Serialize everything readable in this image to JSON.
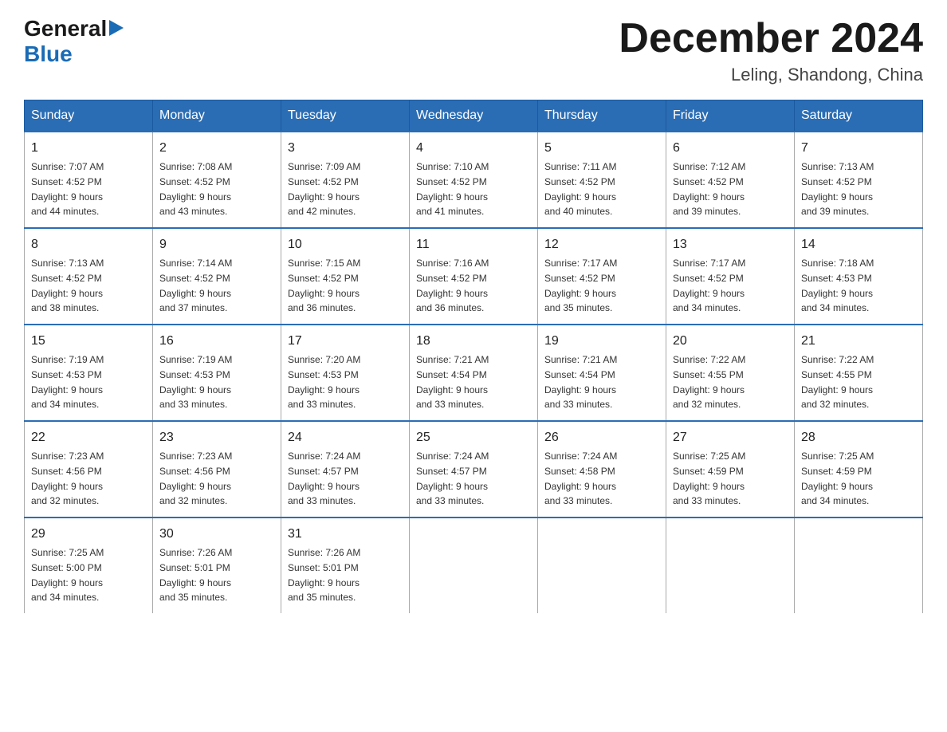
{
  "logo": {
    "general": "General",
    "arrow": "▶",
    "blue": "Blue"
  },
  "title": {
    "month_year": "December 2024",
    "location": "Leling, Shandong, China"
  },
  "headers": [
    "Sunday",
    "Monday",
    "Tuesday",
    "Wednesday",
    "Thursday",
    "Friday",
    "Saturday"
  ],
  "weeks": [
    [
      {
        "day": "1",
        "sunrise": "7:07 AM",
        "sunset": "4:52 PM",
        "daylight": "9 hours and 44 minutes."
      },
      {
        "day": "2",
        "sunrise": "7:08 AM",
        "sunset": "4:52 PM",
        "daylight": "9 hours and 43 minutes."
      },
      {
        "day": "3",
        "sunrise": "7:09 AM",
        "sunset": "4:52 PM",
        "daylight": "9 hours and 42 minutes."
      },
      {
        "day": "4",
        "sunrise": "7:10 AM",
        "sunset": "4:52 PM",
        "daylight": "9 hours and 41 minutes."
      },
      {
        "day": "5",
        "sunrise": "7:11 AM",
        "sunset": "4:52 PM",
        "daylight": "9 hours and 40 minutes."
      },
      {
        "day": "6",
        "sunrise": "7:12 AM",
        "sunset": "4:52 PM",
        "daylight": "9 hours and 39 minutes."
      },
      {
        "day": "7",
        "sunrise": "7:13 AM",
        "sunset": "4:52 PM",
        "daylight": "9 hours and 39 minutes."
      }
    ],
    [
      {
        "day": "8",
        "sunrise": "7:13 AM",
        "sunset": "4:52 PM",
        "daylight": "9 hours and 38 minutes."
      },
      {
        "day": "9",
        "sunrise": "7:14 AM",
        "sunset": "4:52 PM",
        "daylight": "9 hours and 37 minutes."
      },
      {
        "day": "10",
        "sunrise": "7:15 AM",
        "sunset": "4:52 PM",
        "daylight": "9 hours and 36 minutes."
      },
      {
        "day": "11",
        "sunrise": "7:16 AM",
        "sunset": "4:52 PM",
        "daylight": "9 hours and 36 minutes."
      },
      {
        "day": "12",
        "sunrise": "7:17 AM",
        "sunset": "4:52 PM",
        "daylight": "9 hours and 35 minutes."
      },
      {
        "day": "13",
        "sunrise": "7:17 AM",
        "sunset": "4:52 PM",
        "daylight": "9 hours and 34 minutes."
      },
      {
        "day": "14",
        "sunrise": "7:18 AM",
        "sunset": "4:53 PM",
        "daylight": "9 hours and 34 minutes."
      }
    ],
    [
      {
        "day": "15",
        "sunrise": "7:19 AM",
        "sunset": "4:53 PM",
        "daylight": "9 hours and 34 minutes."
      },
      {
        "day": "16",
        "sunrise": "7:19 AM",
        "sunset": "4:53 PM",
        "daylight": "9 hours and 33 minutes."
      },
      {
        "day": "17",
        "sunrise": "7:20 AM",
        "sunset": "4:53 PM",
        "daylight": "9 hours and 33 minutes."
      },
      {
        "day": "18",
        "sunrise": "7:21 AM",
        "sunset": "4:54 PM",
        "daylight": "9 hours and 33 minutes."
      },
      {
        "day": "19",
        "sunrise": "7:21 AM",
        "sunset": "4:54 PM",
        "daylight": "9 hours and 33 minutes."
      },
      {
        "day": "20",
        "sunrise": "7:22 AM",
        "sunset": "4:55 PM",
        "daylight": "9 hours and 32 minutes."
      },
      {
        "day": "21",
        "sunrise": "7:22 AM",
        "sunset": "4:55 PM",
        "daylight": "9 hours and 32 minutes."
      }
    ],
    [
      {
        "day": "22",
        "sunrise": "7:23 AM",
        "sunset": "4:56 PM",
        "daylight": "9 hours and 32 minutes."
      },
      {
        "day": "23",
        "sunrise": "7:23 AM",
        "sunset": "4:56 PM",
        "daylight": "9 hours and 32 minutes."
      },
      {
        "day": "24",
        "sunrise": "7:24 AM",
        "sunset": "4:57 PM",
        "daylight": "9 hours and 33 minutes."
      },
      {
        "day": "25",
        "sunrise": "7:24 AM",
        "sunset": "4:57 PM",
        "daylight": "9 hours and 33 minutes."
      },
      {
        "day": "26",
        "sunrise": "7:24 AM",
        "sunset": "4:58 PM",
        "daylight": "9 hours and 33 minutes."
      },
      {
        "day": "27",
        "sunrise": "7:25 AM",
        "sunset": "4:59 PM",
        "daylight": "9 hours and 33 minutes."
      },
      {
        "day": "28",
        "sunrise": "7:25 AM",
        "sunset": "4:59 PM",
        "daylight": "9 hours and 34 minutes."
      }
    ],
    [
      {
        "day": "29",
        "sunrise": "7:25 AM",
        "sunset": "5:00 PM",
        "daylight": "9 hours and 34 minutes."
      },
      {
        "day": "30",
        "sunrise": "7:26 AM",
        "sunset": "5:01 PM",
        "daylight": "9 hours and 35 minutes."
      },
      {
        "day": "31",
        "sunrise": "7:26 AM",
        "sunset": "5:01 PM",
        "daylight": "9 hours and 35 minutes."
      },
      null,
      null,
      null,
      null
    ]
  ],
  "labels": {
    "sunrise": "Sunrise: ",
    "sunset": "Sunset: ",
    "daylight": "Daylight: "
  }
}
